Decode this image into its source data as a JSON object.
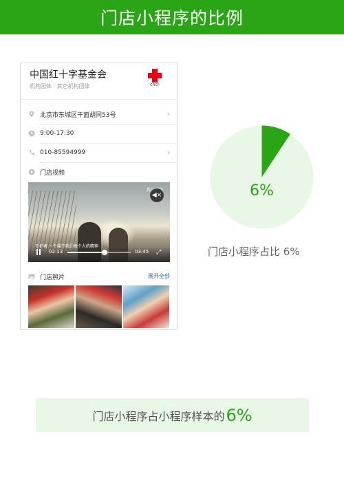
{
  "header": {
    "title": "门店小程序的比例"
  },
  "card": {
    "org_name": "中国红十字基金会",
    "org_sub": "机构团体 · 其它机构团体",
    "logo_text": "CRCF",
    "rows": [
      {
        "text": "北京市东城区干面胡同53号",
        "icon": "location-icon",
        "chevron": true
      },
      {
        "text": "9:00-17:30",
        "icon": "clock-icon",
        "chevron": false
      },
      {
        "text": "010-85594999",
        "icon": "phone-icon",
        "chevron": true
      },
      {
        "text": "门店视频",
        "icon": "video-icon",
        "chevron": false
      }
    ],
    "video": {
      "brand": "腾讯视频",
      "caption": "守护者 一个属于我们每个人的精神",
      "current_time": "02:13",
      "duration": "03:45",
      "progress": 0.59
    },
    "photos": {
      "label": "门店照片",
      "expand_label": "展开全部"
    }
  },
  "donut": {
    "value_label": "6%",
    "value": 6,
    "caption": "门店小程序占比 6%"
  },
  "banner": {
    "text": "门店小程序占小程序样本的",
    "pct": "6%"
  },
  "colors": {
    "accent": "#2aa515",
    "light": "#e9f7e6"
  }
}
